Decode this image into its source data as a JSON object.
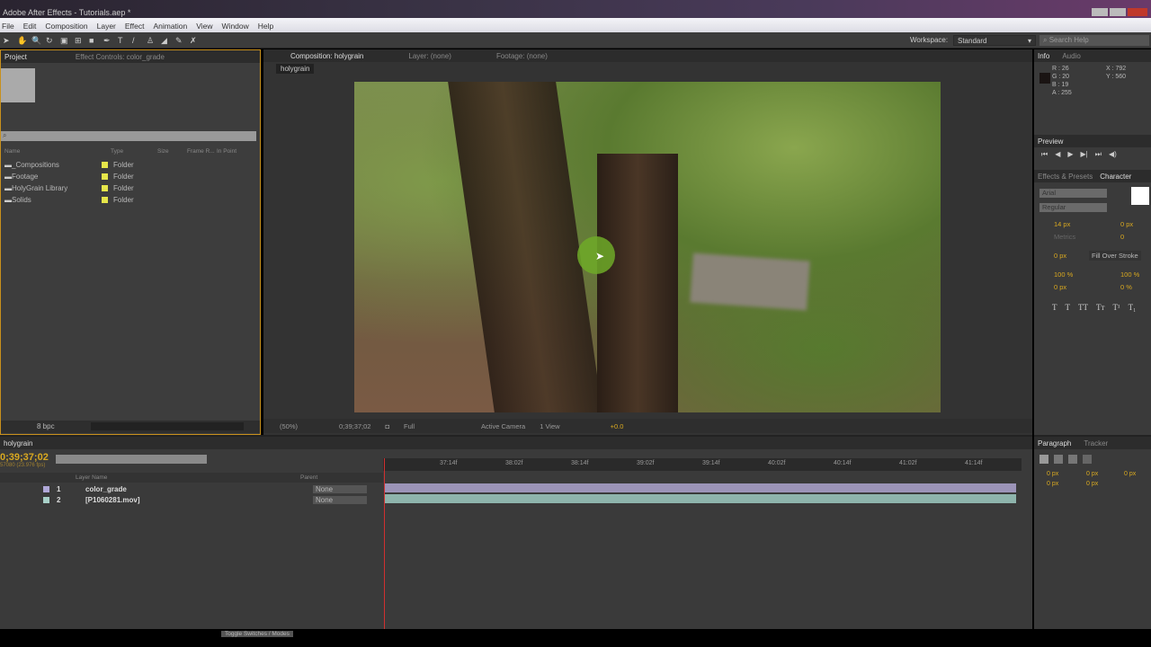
{
  "window": {
    "title": "Adobe After Effects - Tutorials.aep *"
  },
  "menu": [
    "File",
    "Edit",
    "Composition",
    "Layer",
    "Effect",
    "Animation",
    "View",
    "Window",
    "Help"
  ],
  "toolbar": {
    "workspace_label": "Workspace:",
    "workspace_value": "Standard",
    "search_placeholder": "Search Help"
  },
  "project": {
    "tabs": [
      "Project",
      "Effect Controls: color_grade"
    ],
    "search_placeholder": "⌕",
    "columns": [
      "Name",
      "Type",
      "Size",
      "Frame R...",
      "In Point"
    ],
    "items": [
      {
        "name": "_Compositions",
        "type": "Folder"
      },
      {
        "name": "Footage",
        "type": "Folder"
      },
      {
        "name": "HolyGrain Library",
        "type": "Folder"
      },
      {
        "name": "Solids",
        "type": "Folder"
      }
    ],
    "bpc": "8 bpc"
  },
  "comp": {
    "tabs": [
      "Composition: holygrain",
      "Layer: (none)",
      "Footage: (none)"
    ],
    "breadcrumb": "holygrain",
    "zoom": "(50%)",
    "timecode": "0;39;37;02",
    "resolution": "Full",
    "camera": "Active Camera",
    "views": "1 View",
    "exposure": "+0.0"
  },
  "info": {
    "tabs": [
      "Info",
      "Audio"
    ],
    "r": "R : 26",
    "g": "G : 20",
    "b": "B : 19",
    "a": "A : 255",
    "x": "X : 792",
    "y": "Y : 560"
  },
  "preview": {
    "tab": "Preview"
  },
  "character": {
    "tabs": [
      "Effects & Presets",
      "Character"
    ],
    "font": "Arial",
    "style": "Regular",
    "size": "14 px",
    "leading": "0 px",
    "kerning": "Metrics",
    "tracking": "0",
    "stroke": "0 px",
    "stroke_mode": "Fill Over Stroke",
    "vscale": "100 %",
    "hscale": "100 %",
    "baseline": "0 px",
    "tsume": "0 %",
    "styles": [
      "T",
      "T",
      "TT",
      "Tт",
      "T¹",
      "T₁"
    ]
  },
  "timeline": {
    "tab": "holygrain",
    "timecode": "0;39;37;02",
    "fps": "57080 (23.976 fps)",
    "columns": {
      "layer_name": "Layer Name",
      "parent": "Parent"
    },
    "layers": [
      {
        "num": "1",
        "name": "color_grade",
        "parent": "None",
        "color": "#b0a8d8"
      },
      {
        "num": "2",
        "name": "[P1060281.mov]",
        "parent": "None",
        "color": "#a8d0c8"
      }
    ],
    "ruler": [
      "37:14f",
      "38:02f",
      "38:14f",
      "39:02f",
      "39:14f",
      "40:02f",
      "40:14f",
      "41:02f",
      "41:14f"
    ],
    "toggle": "Toggle Switches / Modes"
  },
  "paragraph": {
    "tabs": [
      "Paragraph",
      "Tracker"
    ],
    "values": [
      "0 px",
      "0 px",
      "0 px",
      "0 px",
      "0 px"
    ]
  }
}
